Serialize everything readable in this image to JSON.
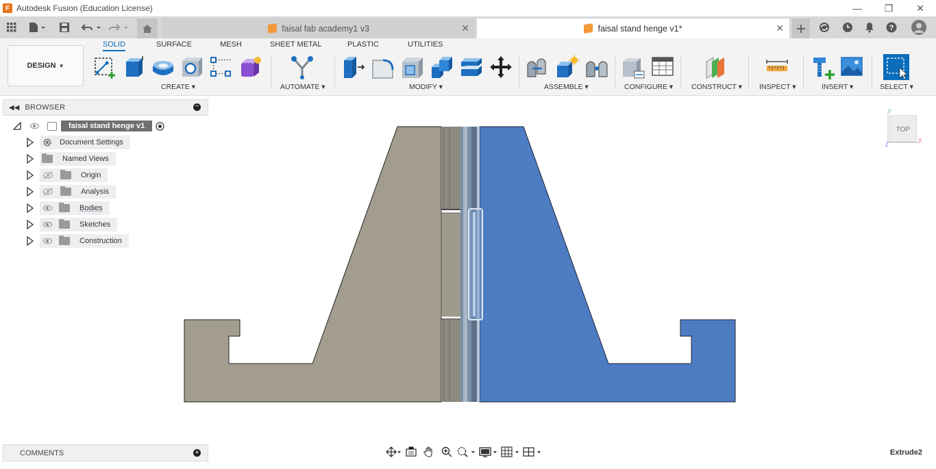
{
  "window": {
    "title": "Autodesk Fusion (Education License)",
    "logo_letter": "F"
  },
  "tabs": [
    {
      "label": "faisal fab academy1 v3",
      "active": false
    },
    {
      "label": "faisal stand henge v1*",
      "active": true
    }
  ],
  "toolbar": {
    "workspace": "DESIGN",
    "workspace_tabs": [
      "SOLID",
      "SURFACE",
      "MESH",
      "SHEET METAL",
      "PLASTIC",
      "UTILITIES"
    ],
    "groups": [
      "CREATE",
      "AUTOMATE",
      "MODIFY",
      "ASSEMBLE",
      "CONFIGURE",
      "CONSTRUCT",
      "INSPECT",
      "INSERT",
      "SELECT"
    ]
  },
  "browser": {
    "title": "BROWSER",
    "root": "faisal stand henge v1",
    "items": [
      {
        "label": "Document Settings",
        "icon": "gear-icon",
        "eye": "none"
      },
      {
        "label": "Named Views",
        "icon": "folder-icon",
        "eye": "none"
      },
      {
        "label": "Origin",
        "icon": "folder-icon",
        "eye": "hidden"
      },
      {
        "label": "Analysis",
        "icon": "folder-icon",
        "eye": "hidden"
      },
      {
        "label": "Bodies",
        "icon": "folder-icon",
        "eye": "visible"
      },
      {
        "label": "Sketches",
        "icon": "folder-icon",
        "eye": "visible"
      },
      {
        "label": "Construction",
        "icon": "folder-icon",
        "eye": "visible"
      }
    ]
  },
  "comments": {
    "title": "COMMENTS"
  },
  "viewcube": {
    "face": "TOP",
    "axis_x": "X",
    "axis_y": "Y",
    "axis_z": "Z"
  },
  "status": {
    "text": "Extrude2"
  },
  "colors": {
    "accent": "#0a6ebd",
    "gray_body": "#a29d8e",
    "blue_body": "#4d7cc3",
    "hinge_pin": "#7a8fa6"
  }
}
